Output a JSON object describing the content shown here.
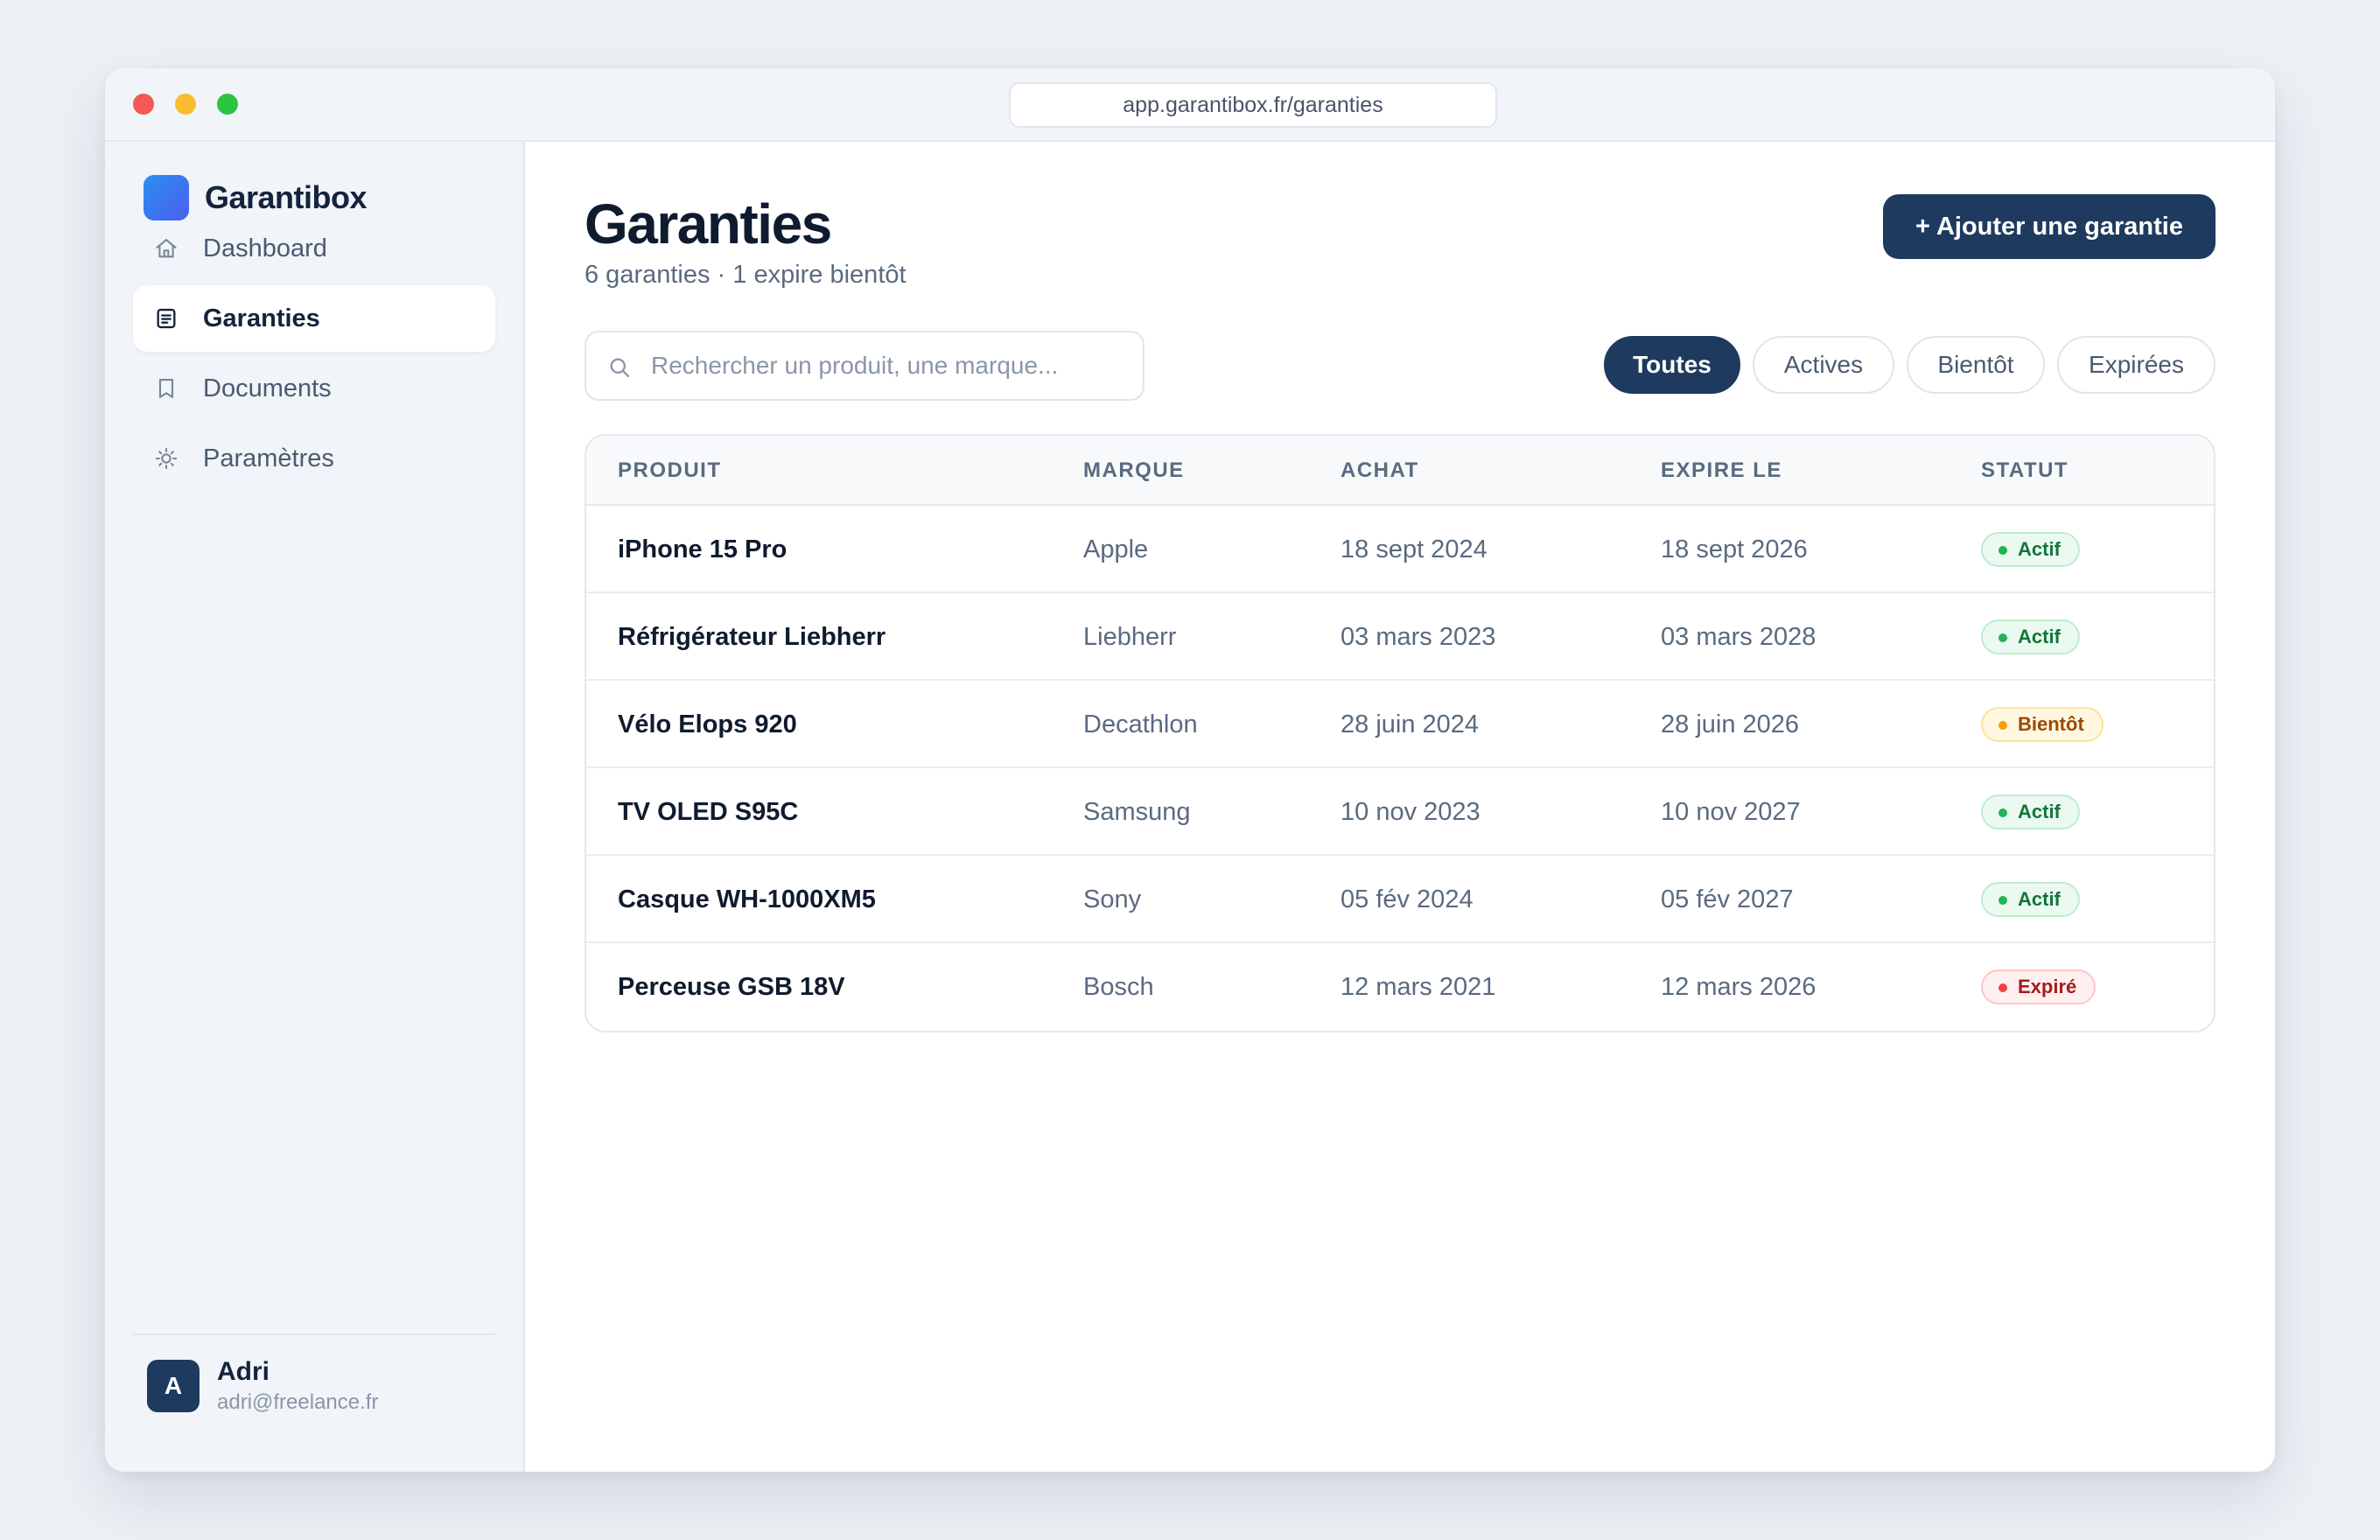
{
  "browser": {
    "url": "app.garantibox.fr/garanties"
  },
  "brand": {
    "name": "Garantibox",
    "accent_from": "#2a8ff0",
    "accent_to": "#4c5ff0"
  },
  "sidebar": {
    "items": [
      {
        "label": "Dashboard",
        "icon": "home-icon",
        "active": false
      },
      {
        "label": "Garanties",
        "icon": "list-icon",
        "active": true
      },
      {
        "label": "Documents",
        "icon": "bookmark-icon",
        "active": false
      },
      {
        "label": "Paramètres",
        "icon": "sun-icon",
        "active": false
      }
    ]
  },
  "user": {
    "initial": "A",
    "name": "Adri",
    "email": "adri@freelance.fr"
  },
  "header": {
    "title": "Garanties",
    "subtitle": "6 garanties · 1 expire bientôt",
    "add_label": "+ Ajouter une garantie"
  },
  "search": {
    "placeholder": "Rechercher un produit, une marque...",
    "value": ""
  },
  "filters": [
    {
      "label": "Toutes",
      "active": true
    },
    {
      "label": "Actives",
      "active": false
    },
    {
      "label": "Bientôt",
      "active": false
    },
    {
      "label": "Expirées",
      "active": false
    }
  ],
  "table": {
    "columns": [
      "PRODUIT",
      "MARQUE",
      "ACHAT",
      "EXPIRE LE",
      "STATUT"
    ],
    "rows": [
      {
        "product": "iPhone 15 Pro",
        "brand": "Apple",
        "purchase": "18 sept 2024",
        "expires": "18 sept 2026",
        "status": "Actif",
        "status_kind": "actif"
      },
      {
        "product": "Réfrigérateur Liebherr",
        "brand": "Liebherr",
        "purchase": "03 mars 2023",
        "expires": "03 mars 2028",
        "status": "Actif",
        "status_kind": "actif"
      },
      {
        "product": "Vélo Elops 920",
        "brand": "Decathlon",
        "purchase": "28 juin 2024",
        "expires": "28 juin 2026",
        "status": "Bientôt",
        "status_kind": "bientot"
      },
      {
        "product": "TV OLED S95C",
        "brand": "Samsung",
        "purchase": "10 nov 2023",
        "expires": "10 nov 2027",
        "status": "Actif",
        "status_kind": "actif"
      },
      {
        "product": "Casque WH-1000XM5",
        "brand": "Sony",
        "purchase": "05 fév 2024",
        "expires": "05 fév 2027",
        "status": "Actif",
        "status_kind": "actif"
      },
      {
        "product": "Perceuse GSB 18V",
        "brand": "Bosch",
        "purchase": "12 mars 2021",
        "expires": "12 mars 2026",
        "status": "Expiré",
        "status_kind": "expire"
      }
    ]
  },
  "colors": {
    "primary": "#1f3a5f",
    "success": "#22b356",
    "warning": "#f59e0b",
    "danger": "#ef4444"
  }
}
